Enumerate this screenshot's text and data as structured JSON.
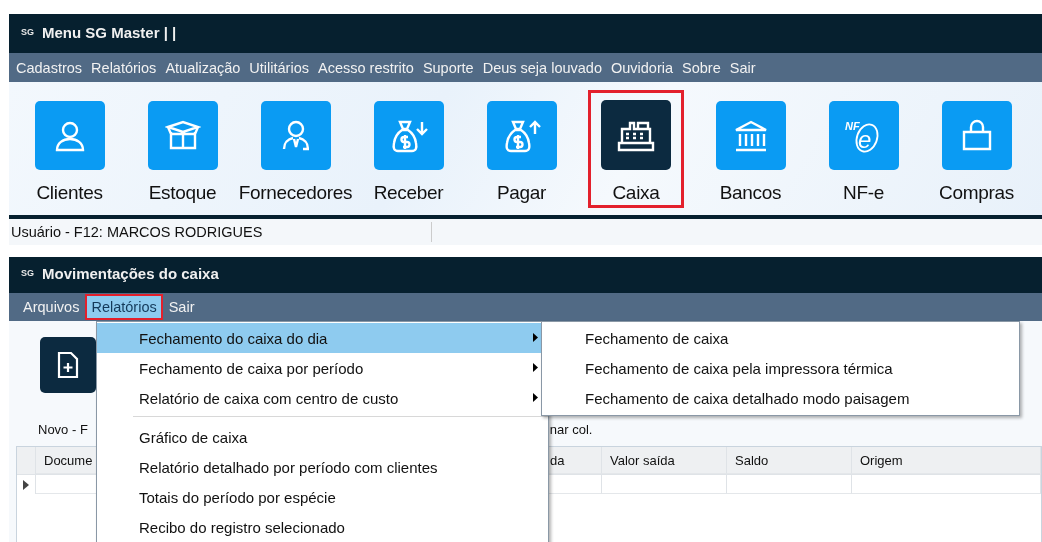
{
  "main_window": {
    "logo": "SG",
    "title": "Menu SG Master | |",
    "menu": [
      "Cadastros",
      "Relatórios",
      "Atualização",
      "Utilitários",
      "Acesso restrito",
      "Suporte",
      "Deus seja louvado",
      "Ouvidoria",
      "Sobre",
      "Sair"
    ],
    "tiles": [
      {
        "label": "Clientes",
        "kind": "person",
        "selected": false,
        "highlighted": false
      },
      {
        "label": "Estoque",
        "kind": "box",
        "selected": false,
        "highlighted": false
      },
      {
        "label": "Fornecedores",
        "kind": "supplier",
        "selected": false,
        "highlighted": false
      },
      {
        "label": "Receber",
        "kind": "receive",
        "selected": false,
        "highlighted": false
      },
      {
        "label": "Pagar",
        "kind": "pay",
        "selected": false,
        "highlighted": false
      },
      {
        "label": "Caixa",
        "kind": "register",
        "selected": true,
        "highlighted": true
      },
      {
        "label": "Bancos",
        "kind": "bank",
        "selected": false,
        "highlighted": false
      },
      {
        "label": "NF-e",
        "kind": "invoice",
        "icon_text": [
          "NF",
          "e"
        ],
        "selected": false,
        "highlighted": false
      },
      {
        "label": "Compras",
        "kind": "shopping",
        "selected": false,
        "highlighted": false
      }
    ],
    "status_bar": {
      "user": "Usuário - F12: MARCOS RODRIGUES"
    }
  },
  "cash_window": {
    "logo": "SG",
    "title": "Movimentações do caixa",
    "menu": [
      {
        "label": "Arquivos",
        "open": false,
        "highlighted": false
      },
      {
        "label": "Relatórios",
        "open": true,
        "highlighted": true
      },
      {
        "label": "Sair",
        "open": false,
        "highlighted": false
      }
    ],
    "new_button_label": "Novo - F",
    "hint": "nar col.",
    "grid": {
      "columns": [
        "Docume",
        "da",
        "Valor saída",
        "Saldo",
        "Origem"
      ]
    },
    "dropdown": [
      {
        "kind": "item",
        "label": "Fechamento do caixa do dia",
        "submenu": true,
        "selected": true
      },
      {
        "kind": "item",
        "label": "Fechamento de caixa por período",
        "submenu": true,
        "selected": false
      },
      {
        "kind": "item",
        "label": "Relatório de caixa com centro de custo",
        "submenu": true,
        "selected": false
      },
      {
        "kind": "separator"
      },
      {
        "kind": "item",
        "label": "Gráfico de caixa",
        "submenu": false,
        "selected": false
      },
      {
        "kind": "item",
        "label": "Relatório detalhado por período com clientes",
        "submenu": false,
        "selected": false
      },
      {
        "kind": "item",
        "label": "Totais do período por espécie",
        "submenu": false,
        "selected": false
      },
      {
        "kind": "item",
        "label": "Recibo do registro selecionado",
        "submenu": false,
        "selected": false
      }
    ],
    "submenu": [
      "Fechamento de caixa",
      "Fechamento de caixa pela impressora térmica",
      "Fechamento de caixa detalhado modo paisagem"
    ]
  }
}
